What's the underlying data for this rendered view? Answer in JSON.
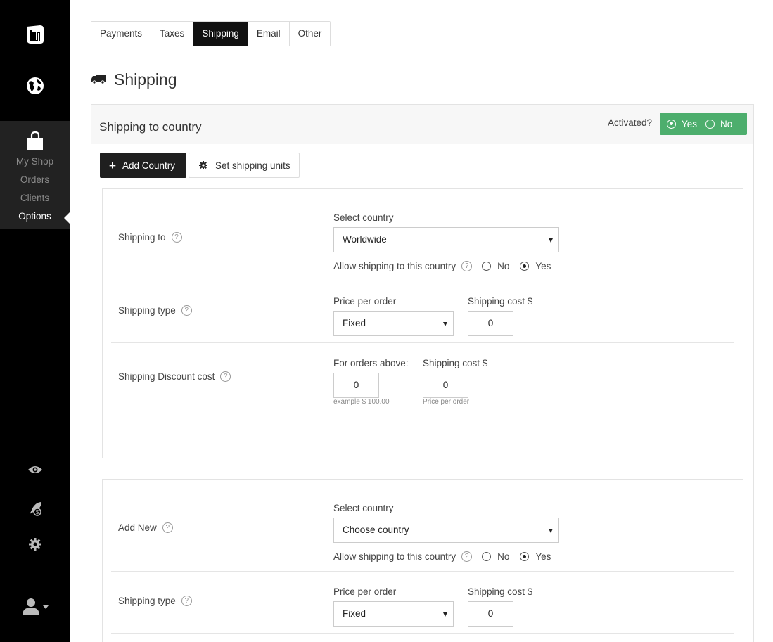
{
  "sidebar": {
    "icons": {
      "logo": "logo-icon",
      "globe": "globe-icon",
      "bag": "shopping-bag-icon",
      "eye": "eye-icon",
      "rocket": "rocket-icon",
      "gear": "gear-icon",
      "user": "user-icon"
    },
    "items": [
      {
        "label": "My Shop"
      },
      {
        "label": "Orders"
      },
      {
        "label": "Clients"
      },
      {
        "label": "Options",
        "active": true
      }
    ]
  },
  "tabs": [
    {
      "label": "Payments"
    },
    {
      "label": "Taxes"
    },
    {
      "label": "Shipping",
      "active": true
    },
    {
      "label": "Email"
    },
    {
      "label": "Other"
    }
  ],
  "page": {
    "title": "Shipping",
    "icon": "truck-icon"
  },
  "panel": {
    "title": "Shipping to country",
    "activated_label": "Activated?",
    "activated_yes": "Yes",
    "activated_no": "No",
    "activated_value": "Yes",
    "activated_color": "#4dae6d",
    "add_country": "Add Country",
    "set_units": "Set shipping units"
  },
  "help_mark": "?",
  "card1": {
    "shipping_to_label": "Shipping to",
    "select_country_label": "Select country",
    "country_value": "Worldwide",
    "allow_label": "Allow shipping to this country",
    "allow_no": "No",
    "allow_yes": "Yes",
    "allow_value": "Yes",
    "shipping_type_label": "Shipping type",
    "price_per_order_label": "Price per order",
    "price_type_value": "Fixed",
    "shipping_cost_label": "Shipping cost $",
    "shipping_cost_value": "0",
    "discount_label": "Shipping Discount cost",
    "orders_above_label": "For orders above:",
    "orders_above_value": "0",
    "orders_above_hint": "example $ 100.00",
    "discount_cost_label": "Shipping cost $",
    "discount_cost_value": "0",
    "discount_cost_hint": "Price per order"
  },
  "card2": {
    "add_new_label": "Add New",
    "select_country_label": "Select country",
    "country_value": "Choose country",
    "allow_label": "Allow shipping to this country",
    "allow_no": "No",
    "allow_yes": "Yes",
    "allow_value": "Yes",
    "shipping_type_label": "Shipping type",
    "price_per_order_label": "Price per order",
    "price_type_value": "Fixed",
    "shipping_cost_label": "Shipping cost $",
    "shipping_cost_value": "0"
  }
}
